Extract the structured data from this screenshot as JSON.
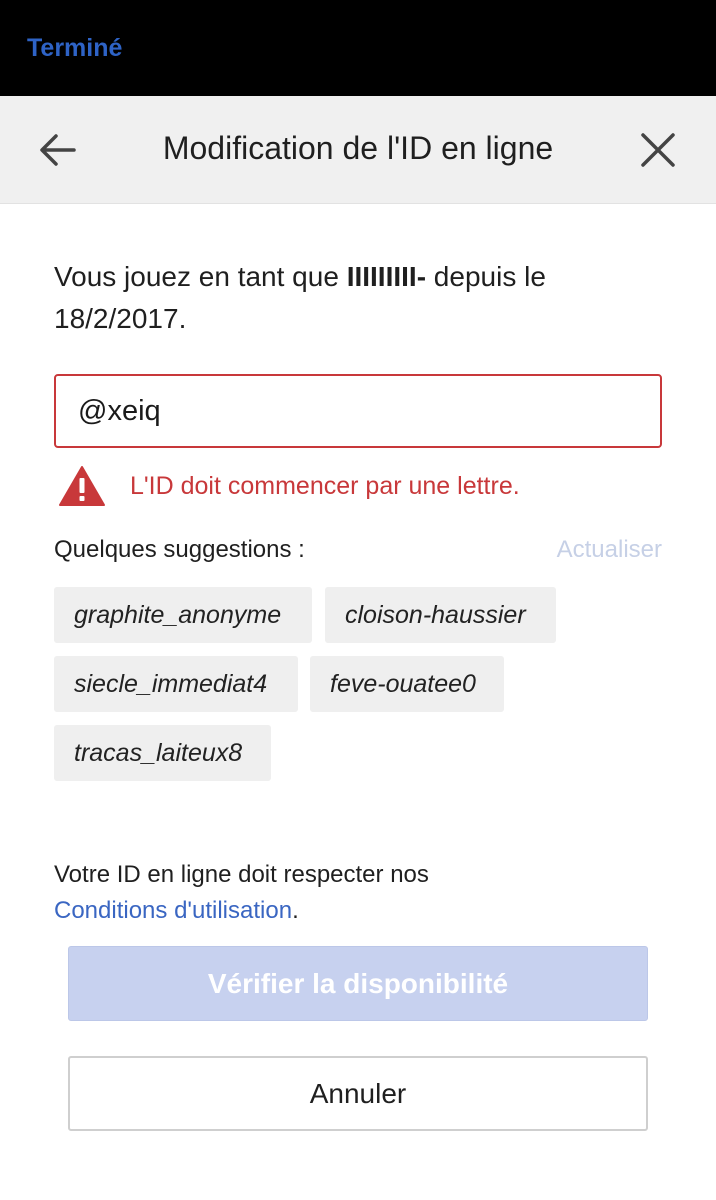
{
  "status_bar": {
    "done_label": "Terminé"
  },
  "header": {
    "title": "Modification de l'ID en ligne",
    "back_icon": "arrow-left-icon",
    "close_icon": "close-icon"
  },
  "intro": {
    "prefix": "Vous jouez en tant que ",
    "gamertag": "IIIIIIIII-",
    "middle": " depuis le ",
    "date": "18/2/2017",
    "suffix": "."
  },
  "id_field": {
    "value": "@xeiq",
    "state": "error"
  },
  "error": {
    "icon": "warning-triangle-icon",
    "message": "L'ID doit commencer par une lettre."
  },
  "suggestions": {
    "label": "Quelques suggestions :",
    "refresh_label": "Actualiser",
    "items": [
      "graphite_anonyme",
      "cloison-haussier",
      "siecle_immediat4",
      "feve-ouatee0",
      "tracas_laiteux8"
    ]
  },
  "terms": {
    "text": "Votre ID en ligne doit respecter nos",
    "link": "Conditions d'utilisation",
    "suffix": "."
  },
  "buttons": {
    "verify": "Vérifier la disponibilité",
    "cancel": "Annuler"
  },
  "colors": {
    "accent": "#2e63c6",
    "error": "#c8383a",
    "link": "#3a66c2",
    "disabled_button": "#c7d1ef",
    "header_bg": "#f0f0f0"
  }
}
